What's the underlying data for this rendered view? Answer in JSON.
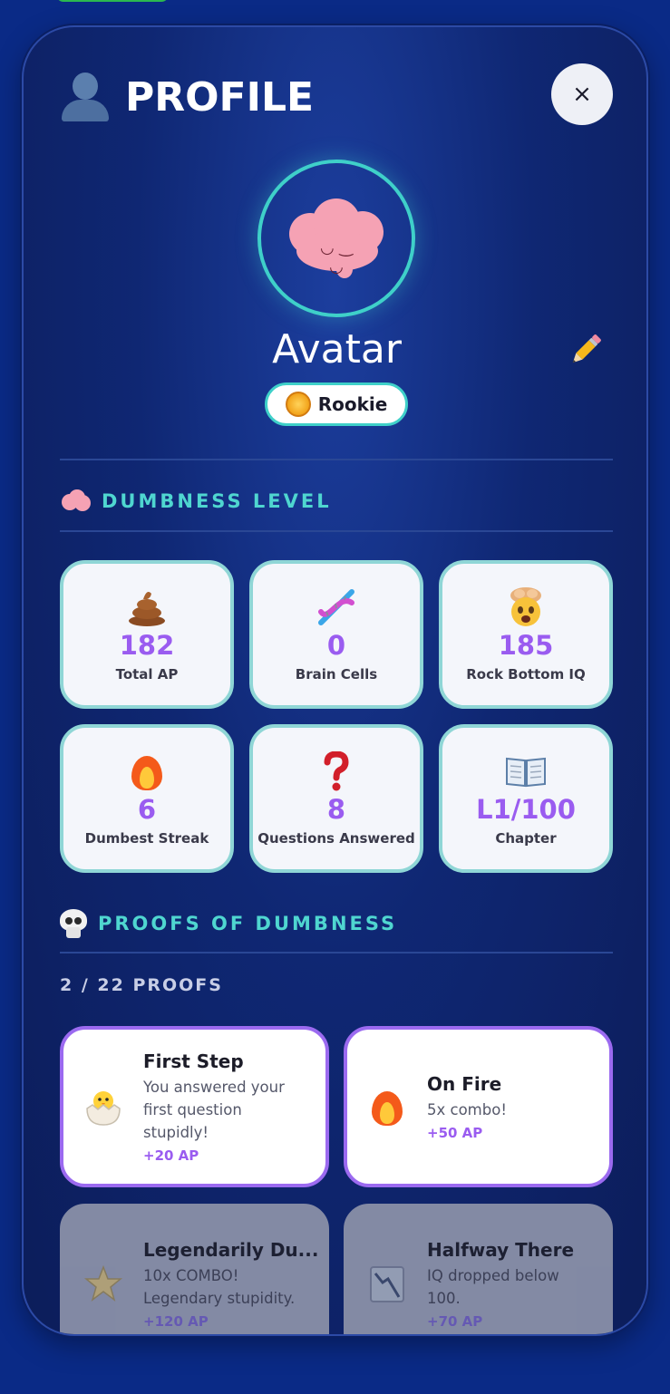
{
  "header": {
    "title": "PROFILE",
    "close_label": "×"
  },
  "profile": {
    "name": "Avatar",
    "rank": "Rookie"
  },
  "sections": {
    "level_title": "DUMBNESS LEVEL",
    "proofs_title": "PROOFS OF DUMBNESS",
    "proofs_count": "2 / 22 PROOFS"
  },
  "stats": [
    {
      "icon": "poop-icon",
      "value": "182",
      "label": "Total AP"
    },
    {
      "icon": "dna-icon",
      "value": "0",
      "label": "Brain Cells"
    },
    {
      "icon": "exploding-head-icon",
      "value": "185",
      "label": "Rock Bottom IQ"
    },
    {
      "icon": "fire-icon",
      "value": "6",
      "label": "Dumbest Streak"
    },
    {
      "icon": "question-mark-icon",
      "value": "8",
      "label": "Questions Answered"
    },
    {
      "icon": "open-book-icon",
      "value": "L1/100",
      "label": "Chapter"
    }
  ],
  "proofs": [
    {
      "icon": "hatching-chick-icon",
      "title": "First Step",
      "desc": "You answered your first question stupidly!",
      "reward": "+20 AP",
      "unlocked": true
    },
    {
      "icon": "fire-icon",
      "title": "On Fire",
      "desc": "5x combo!",
      "reward": "+50 AP",
      "unlocked": true
    },
    {
      "icon": "star-icon",
      "title": "Legendarily Du...",
      "desc": "10x COMBO! Legendary stupidity.",
      "reward": "+120 AP",
      "unlocked": false
    },
    {
      "icon": "chart-down-icon",
      "title": "Halfway There",
      "desc": "IQ dropped below 100.",
      "reward": "+70 AP",
      "unlocked": false
    }
  ],
  "colors": {
    "accent": "#4fd6d0",
    "value": "#9a5cf0",
    "background": "#0a2a86"
  }
}
